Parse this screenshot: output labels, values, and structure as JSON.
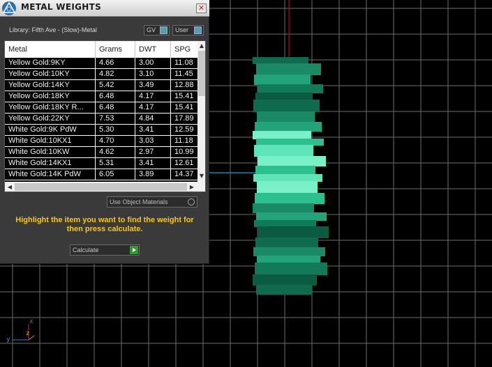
{
  "dialog": {
    "title": "METAL WEIGHTS",
    "close_label": "✕",
    "library_label": "Library: Fifth Ave - (Slow)-Metal",
    "toggles": {
      "gv": "GV",
      "user": "User"
    },
    "table": {
      "headers": [
        "Metal",
        "Grams",
        "DWT",
        "SPG"
      ],
      "rows": [
        [
          "Yellow Gold:9KY",
          "4.66",
          "3.00",
          "11.08"
        ],
        [
          "Yellow Gold:10KY",
          "4.82",
          "3.10",
          "11.45"
        ],
        [
          "Yellow Gold:14KY",
          "5.42",
          "3.49",
          "12.88"
        ],
        [
          "Yellow Gold:18KY",
          "6.48",
          "4.17",
          "15.41"
        ],
        [
          "Yellow Gold:18KY R...",
          "6.48",
          "4.17",
          "15.41"
        ],
        [
          "Yellow Gold:22KY",
          "7.53",
          "4.84",
          "17.89"
        ],
        [
          "White Gold:9K PdW",
          "5.30",
          "3.41",
          "12.59"
        ],
        [
          "White Gold:10KX1",
          "4.70",
          "3.03",
          "11.18"
        ],
        [
          "White Gold:10KW",
          "4.62",
          "2.97",
          "10.99"
        ],
        [
          "White Gold:14KX1",
          "5.31",
          "3.41",
          "12.61"
        ],
        [
          "White Gold:14K PdW",
          "6.05",
          "3.89",
          "14.37"
        ]
      ]
    },
    "use_object_materials": "Use Object Materials",
    "instructions": "Highlight the item you want to find the weight for then press calculate.",
    "calculate_label": "Calculate"
  },
  "viewport": {
    "axis_labels": {
      "x": "x",
      "y": "y",
      "z": "z"
    },
    "colors": {
      "grid": "#6e6e6e",
      "axis_vertical": "#c00000",
      "axis_horizontal": "#1a9ad6",
      "model": "#1e8a6a"
    }
  }
}
